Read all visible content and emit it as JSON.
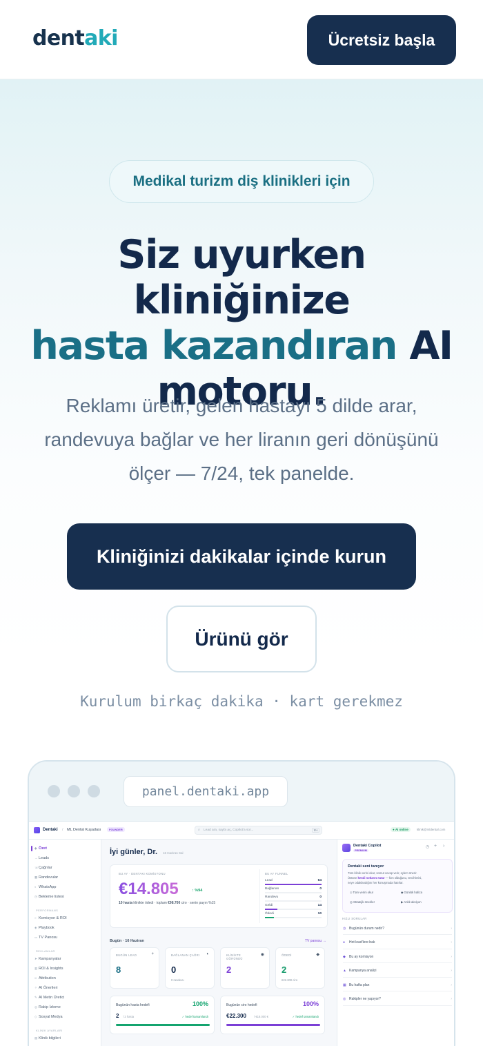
{
  "header": {
    "logo_main": "dent",
    "logo_accent": "aki",
    "cta": "Ücretsiz başla"
  },
  "hero": {
    "badge": "Medikal turizm diş klinikleri için",
    "headline_1": "Siz uyurken kliniğinize",
    "headline_highlight": "hasta kazandıran",
    "headline_2": " AI motoru.",
    "subtitle": "Reklamı üretir, gelen hastayı 5 dilde arar, randevuya bağlar ve her liranın geri dönüşünü ölçer — 7/24, tek panelde.",
    "primary_cta": "Kliniğinizi dakikalar içinde kurun",
    "secondary_cta": "Ürünü gör",
    "note": "Kurulum birkaç dakika · kart gerekmez"
  },
  "browser": {
    "url": "panel.dentaki.app"
  },
  "dashboard": {
    "brand": "Dentaki",
    "clinic": "ML Dental Kuşadası",
    "plan_badge": "FOUNDER",
    "search_placeholder": "Lead ara, sayfa aç, Copilot'a sor...",
    "search_shortcut": "⌘K",
    "ai_status": "AI online",
    "user_email": "klinik@mldental.com",
    "sidebar": {
      "items_main": [
        "Özet",
        "Leads",
        "Çağrılar",
        "Randevular",
        "WhatsApp",
        "Bekleme listesi"
      ],
      "section_performance": "PERFORMANS",
      "items_performance": [
        "Komisyon & ROI",
        "Playbook",
        "TV Panosu"
      ],
      "section_ads": "REKLAMLAR",
      "items_ads": [
        "Kampanyalar",
        "ROI & Insights",
        "Attribution",
        "AI Önerileri",
        "AI Metin Üretici",
        "Rakip İzleme",
        "Sosyal Medya"
      ],
      "section_clinic": "KLİNİK AYARLARI",
      "items_clinic": [
        "Klinik bilgileri"
      ]
    },
    "greeting": "İyi günler, Dr.",
    "greeting_date": "16 Haziran Sal",
    "commission": {
      "label": "BU AY · DENTAKI KOMİSYONU",
      "amount": "€14.805",
      "change": "↑ %94",
      "detail_pre": "10 hasta",
      "detail_mid": " klinikte ödedi · toplam ",
      "detail_total": "€98.700",
      "detail_post": " ciro · senin payın %15"
    },
    "funnel": {
      "title": "BU AY FUNNEL",
      "rows": [
        {
          "label": "Lead",
          "value": "64",
          "fill": 1.0
        },
        {
          "label": "Bağlanan",
          "value": "0",
          "fill": 0.0
        },
        {
          "label": "Randevu",
          "value": "0",
          "fill": 0.0
        },
        {
          "label": "Geldi",
          "value": "14",
          "fill": 0.22
        },
        {
          "label": "Ödedi",
          "value": "10",
          "fill": 0.16
        }
      ]
    },
    "today": {
      "title": "Bugün · 16 Haziran",
      "link": "TV panosu →",
      "stats": [
        {
          "label": "BUGÜN LEAD",
          "value": "8",
          "sub": "",
          "color": "#1a6f86",
          "icon": "+"
        },
        {
          "label": "BAĞLANAN ÇAĞRI",
          "value": "0",
          "sub": "0 randevu",
          "color": "#13294b",
          "icon": "◐"
        },
        {
          "label": "KLİNİKTE GÖRÜNDÜ",
          "value": "2",
          "sub": "",
          "color": "#7b3fd6",
          "icon": "◉"
        },
        {
          "label": "ÖDEDİ",
          "value": "2",
          "sub": "€22.300 ciro",
          "color": "#149a6a",
          "icon": "◆"
        }
      ]
    },
    "goals": [
      {
        "title": "Bugünün hasta hedefi",
        "pct": "100%",
        "value": "2",
        "value_sub": "/ 2 hasta",
        "status": "✓ hedef tamamlandı",
        "color": "#14a46f",
        "fill": 1.0
      },
      {
        "title": "Bugünün ciro hedefi",
        "pct": "100%",
        "value": "€22.300",
        "value_sub": "/ €18.000 €",
        "status": "✓ hedef tamamlandı",
        "color": "#7b3fd6",
        "fill": 1.0
      }
    ],
    "copilot": {
      "title": "Dentaki Copilot",
      "badge": "PREMIUM",
      "card_title": "Dentaki seni tanıyor",
      "card_text_1": "Tüm klinik verini okur, somut cevap verir, eylem önerir.",
      "card_text_2a": "Üstüne ",
      "card_text_2b": "kendi notlarını tutar",
      "card_text_2c": " — kim olduğunu, tercihlerini,",
      "card_text_3": "neye odaklandığını her konuşmada hatırlar.",
      "chips": [
        "Tüm verini okur",
        "Günlük hafıza",
        "Stratejik öneriler",
        "Anlık aksiyon"
      ],
      "quick_title": "HIZLI SORULAR",
      "questions": [
        "Bugünün durum nedir?",
        "Hot lead'lere bak",
        "Bu ay komisyon",
        "Kampanya analizi",
        "Bu hafta plan",
        "Rakipler ne yapıyor?"
      ],
      "question_icons": [
        "◷",
        "●",
        "◆",
        "▲",
        "▦",
        "◎"
      ]
    }
  }
}
